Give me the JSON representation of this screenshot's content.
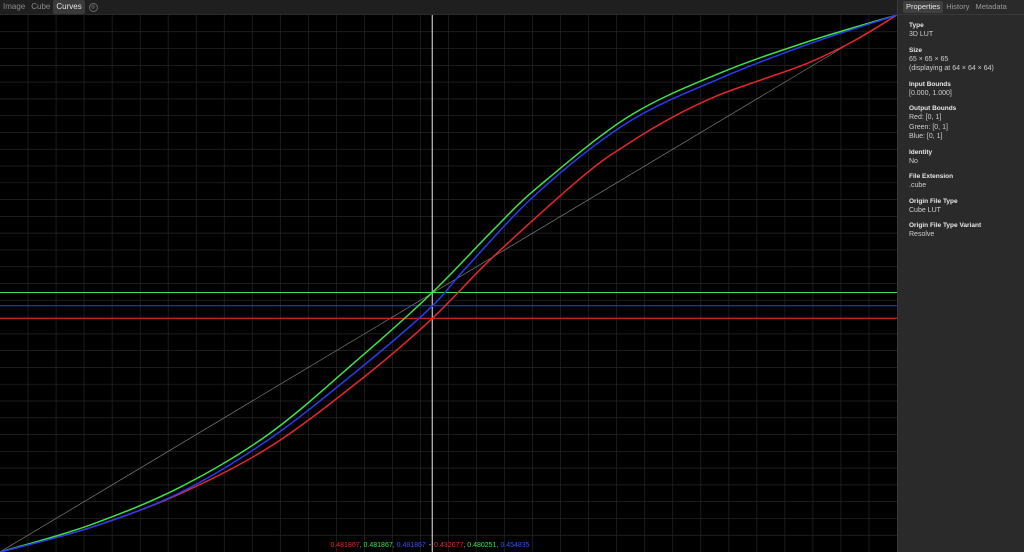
{
  "toolbar": {
    "tabs": [
      {
        "label": "Image",
        "active": false
      },
      {
        "label": "Cube",
        "active": false
      },
      {
        "label": "Curves",
        "active": true
      }
    ],
    "view_icon": "lut-view-icon"
  },
  "panel": {
    "tabs": [
      {
        "label": "Properties",
        "active": true
      },
      {
        "label": "History",
        "active": false
      },
      {
        "label": "Metadata",
        "active": false
      }
    ],
    "properties": [
      {
        "label": "Type",
        "values": [
          "3D LUT"
        ]
      },
      {
        "label": "Size",
        "values": [
          "65 × 65 × 65",
          "(displaying at 64 × 64 × 64)"
        ]
      },
      {
        "label": "Input Bounds",
        "values": [
          "[0.000, 1.000]"
        ]
      },
      {
        "label": "Output Bounds",
        "values": [
          "Red: [0, 1]",
          "Green: [0, 1]",
          "Blue: [0, 1]"
        ]
      },
      {
        "label": "Identity",
        "values": [
          "No"
        ]
      },
      {
        "label": "File Extension",
        "values": [
          ".cube"
        ]
      },
      {
        "label": "Origin File Type",
        "values": [
          "Cube LUT"
        ]
      },
      {
        "label": "Origin File Type Variant",
        "values": [
          "Resolve"
        ]
      }
    ]
  },
  "readout": {
    "input": {
      "r": "0.481867",
      "g": "0.481867",
      "b": "0.481867"
    },
    "separator": "-",
    "output": {
      "r": "0.432677",
      "g": "0.480251",
      "b": "0.454835"
    }
  },
  "colors": {
    "red": "#e8262b",
    "green": "#3ee24a",
    "blue": "#2a3cf0",
    "cyan": "#36d6d6",
    "magenta": "#b030c0",
    "grid": "#262626",
    "identity": "#8a8a8a",
    "cursor": "#e8e8e8"
  },
  "chart_data": {
    "type": "line",
    "cursor_input": 0.481867,
    "xlim": [
      0,
      1
    ],
    "ylim": [
      0,
      1
    ],
    "grid_divisions": 32,
    "series": [
      {
        "color": "red",
        "points": [
          [
            0,
            0
          ],
          [
            0.1,
            0.045
          ],
          [
            0.2,
            0.108
          ],
          [
            0.3,
            0.195
          ],
          [
            0.4,
            0.318
          ],
          [
            0.48,
            0.432
          ],
          [
            0.55,
            0.55
          ],
          [
            0.65,
            0.7
          ],
          [
            0.7,
            0.76
          ],
          [
            0.75,
            0.81
          ],
          [
            0.8,
            0.85
          ],
          [
            0.85,
            0.88
          ],
          [
            0.9,
            0.91
          ],
          [
            0.95,
            0.95
          ],
          [
            1,
            1
          ]
        ]
      },
      {
        "color": "green",
        "points": [
          [
            0,
            0
          ],
          [
            0.1,
            0.05
          ],
          [
            0.2,
            0.12
          ],
          [
            0.3,
            0.22
          ],
          [
            0.4,
            0.36
          ],
          [
            0.48,
            0.48
          ],
          [
            0.55,
            0.6
          ],
          [
            0.6,
            0.68
          ],
          [
            0.7,
            0.81
          ],
          [
            0.8,
            0.89
          ],
          [
            0.9,
            0.95
          ],
          [
            1,
            1
          ]
        ]
      },
      {
        "color": "blue",
        "points": [
          [
            0,
            0
          ],
          [
            0.1,
            0.045
          ],
          [
            0.2,
            0.11
          ],
          [
            0.3,
            0.21
          ],
          [
            0.4,
            0.34
          ],
          [
            0.48,
            0.455
          ],
          [
            0.52,
            0.53
          ],
          [
            0.6,
            0.67
          ],
          [
            0.7,
            0.8
          ],
          [
            0.8,
            0.88
          ],
          [
            0.9,
            0.945
          ],
          [
            1,
            1
          ]
        ]
      }
    ]
  }
}
